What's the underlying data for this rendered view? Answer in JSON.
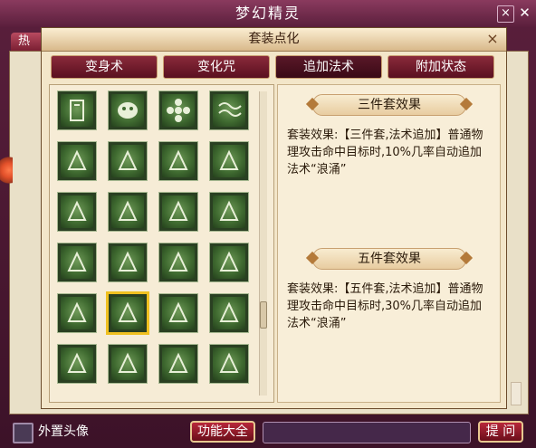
{
  "window": {
    "title": "梦幻精灵",
    "close_label": "×"
  },
  "background": {
    "tab_label": "热"
  },
  "dialog": {
    "title": "套装点化",
    "close_label": "×"
  },
  "tabs": [
    {
      "label": "变身术"
    },
    {
      "label": "变化咒"
    },
    {
      "label": "追加法术"
    },
    {
      "label": "附加状态"
    }
  ],
  "active_tab": "追加法术",
  "icons": [
    "stone-tablet",
    "mask",
    "flower",
    "waves",
    "mountains",
    "tree",
    "fire-emblem",
    "maze",
    "arrows",
    "swirl",
    "beetle",
    "leaf",
    "bear",
    "serpent",
    "raven",
    "claw",
    "demon-face",
    "surge-wave",
    "peaks",
    "wind",
    "totem",
    "torrent",
    "vortex",
    "flame"
  ],
  "selected_icon": "surge-wave",
  "sections": [
    {
      "heading": "三件套效果",
      "text": "套装效果:【三件套,法术追加】普通物理攻击命中目标时,10%几率自动追加法术“浪涌”"
    },
    {
      "heading": "五件套效果",
      "text": "套装效果:【五件套,法术追加】普通物理攻击命中目标时,30%几率自动追加法术“浪涌”"
    }
  ],
  "bottom": {
    "checkbox_label": "外置头像",
    "function_button": "功能大全",
    "help_button": "提 问"
  },
  "colors": {
    "accent": "#6a0e1a",
    "panel": "#f3e6c9",
    "icon_green": "#3f6a30",
    "selected": "#f0c020"
  }
}
